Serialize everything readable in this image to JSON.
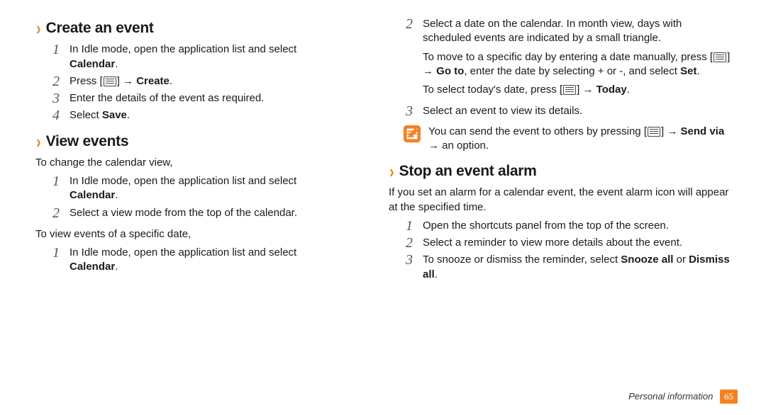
{
  "footer": {
    "section": "Personal information",
    "page": "65"
  },
  "arrow": "→",
  "left": {
    "create_event": {
      "title": "Create an event",
      "steps": [
        {
          "n": "1",
          "pre": "In Idle mode, open the application list and select ",
          "bold": "Calendar",
          "post": "."
        },
        {
          "n": "2",
          "pre": "Press [",
          "after_icon": "] ",
          "arrow": "→",
          "bold": " Create",
          "post": "."
        },
        {
          "n": "3",
          "pre": "Enter the details of the event as required.",
          "bold": "",
          "post": ""
        },
        {
          "n": "4",
          "pre": "Select ",
          "bold": "Save",
          "post": "."
        }
      ]
    },
    "view_events": {
      "title": "View events",
      "intro": "To change the calendar view,",
      "steps_a": [
        {
          "n": "1",
          "pre": "In Idle mode, open the application list and select ",
          "bold": "Calendar",
          "post": "."
        },
        {
          "n": "2",
          "pre": "Select a view mode from the top of the calendar.",
          "bold": "",
          "post": ""
        }
      ],
      "mid": "To view events of a specific date,",
      "steps_b": [
        {
          "n": "1",
          "pre": "In Idle mode, open the application list and select ",
          "bold": "Calendar",
          "post": "."
        }
      ]
    }
  },
  "right": {
    "step2": {
      "n": "2",
      "line1": "Select a date on the calendar. In month view, days with scheduled events are indicated by a small triangle.",
      "line2_pre": "To move to a specific day by entering a date manually, press [",
      "line2_after_icon": "] ",
      "line2_arrow": "→",
      "line2_goto": " Go to",
      "line2_mid": ", enter the date by selecting + or -, and select ",
      "line2_set": "Set",
      "line2_end": ".",
      "line3_pre": "To select today's date, press [",
      "line3_after_icon": "] ",
      "line3_arrow": "→",
      "line3_today": " Today",
      "line3_end": "."
    },
    "step3": {
      "n": "3",
      "text": "Select an event to view its details."
    },
    "note": {
      "pre": "You can send the event to others by pressing [",
      "after_icon": "] ",
      "arrow1": "→",
      "sendvia": " Send via ",
      "arrow2": "→",
      "post": " an option."
    },
    "stop_alarm": {
      "title": "Stop an event alarm",
      "intro": "If you set an alarm for a calendar event, the event alarm icon will appear at the specified time.",
      "steps": [
        {
          "n": "1",
          "text": "Open the shortcuts panel from the top of the screen."
        },
        {
          "n": "2",
          "text": "Select a reminder to view more details about the event."
        },
        {
          "n": "3",
          "pre": "To snooze or dismiss the reminder, select ",
          "b1": "Snooze all",
          "mid": " or ",
          "b2": "Dismiss all",
          "post": "."
        }
      ]
    }
  }
}
